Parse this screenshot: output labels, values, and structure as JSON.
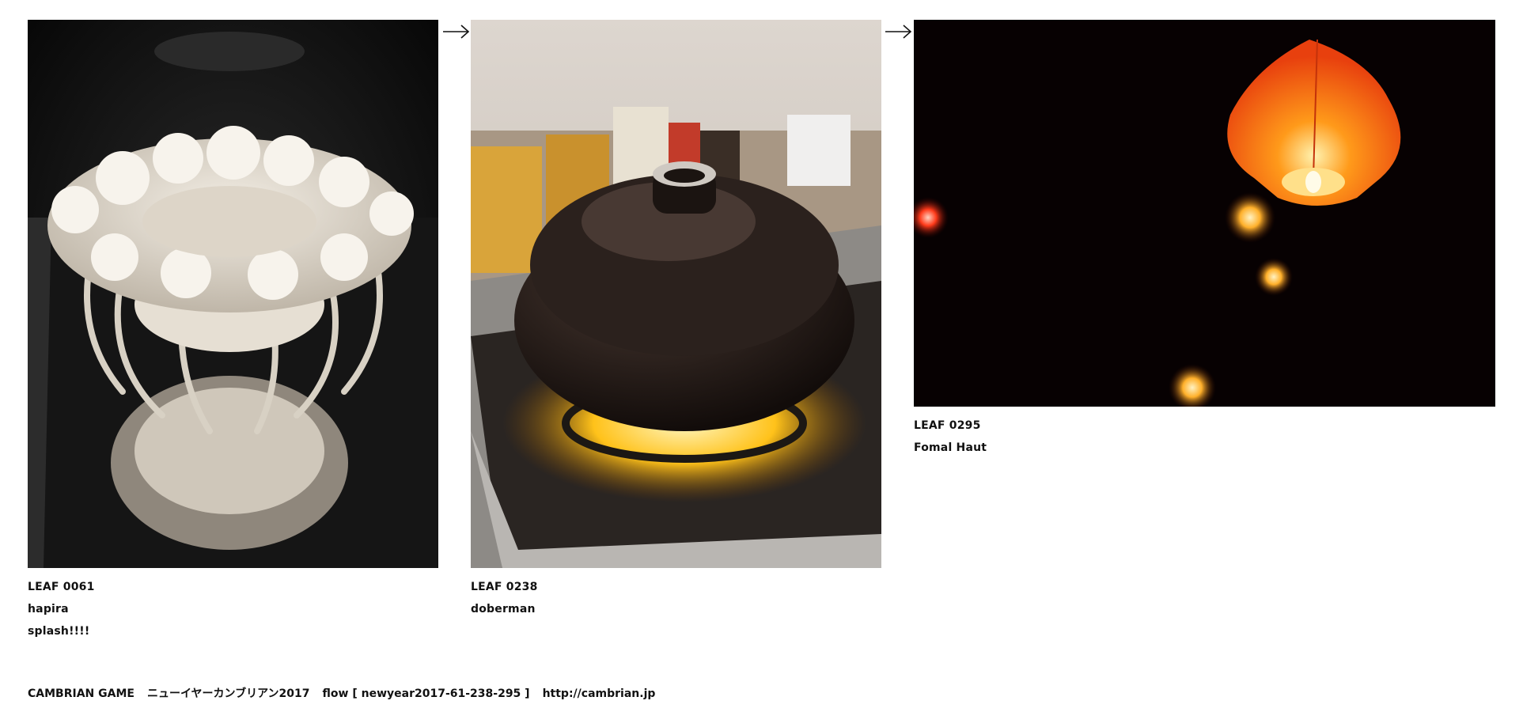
{
  "leaves": [
    {
      "leaf_id": "LEAF 0061",
      "lines": [
        "hapira",
        "splash!!!!"
      ],
      "image": "white-coral-sculpture"
    },
    {
      "leaf_id": "LEAF 0238",
      "lines": [
        "doberman"
      ],
      "image": "clay-pot-on-stove"
    },
    {
      "leaf_id": "LEAF 0295",
      "lines": [
        "Fomal Haut"
      ],
      "image": "sky-lanterns-night"
    }
  ],
  "footer": {
    "game": "CAMBRIAN GAME",
    "title": "ニューイヤーカンブリアン2017",
    "flow": "flow [ newyear2017-61-238-295 ]",
    "url": "http://cambrian.jp"
  },
  "icons": {
    "separator": "right-arrow-icon"
  }
}
